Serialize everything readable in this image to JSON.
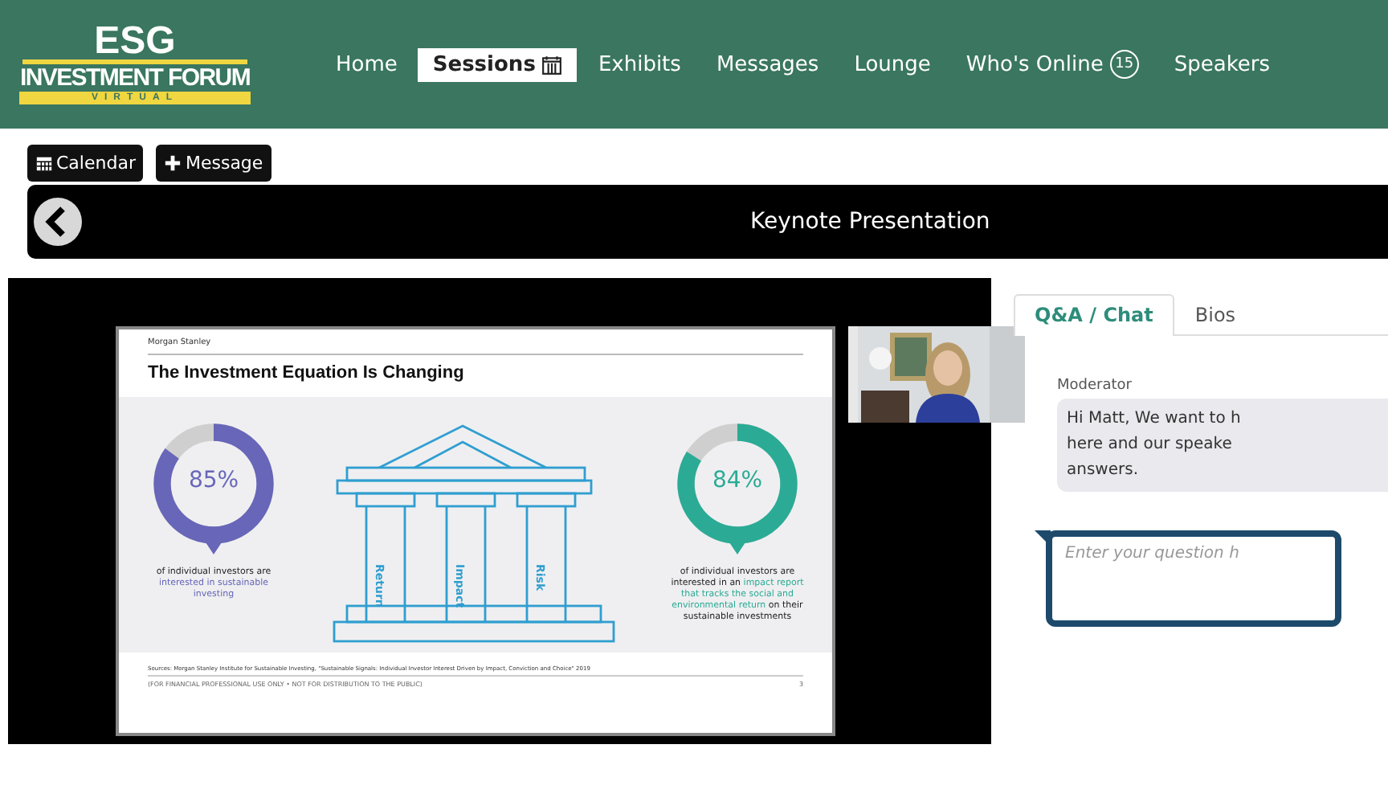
{
  "logo": {
    "top": "ESG",
    "middle": "INVESTMENT FORUM",
    "bottom": "VIRTUAL"
  },
  "nav": [
    {
      "label": "Home",
      "selected": false
    },
    {
      "label": "Sessions",
      "selected": true
    },
    {
      "label": "Exhibits",
      "selected": false
    },
    {
      "label": "Messages",
      "selected": false
    },
    {
      "label": "Lounge",
      "selected": false
    },
    {
      "label": "Who's Online",
      "selected": false,
      "badge": "15"
    },
    {
      "label": "Speakers",
      "selected": false
    }
  ],
  "actions": [
    {
      "label": "Calendar"
    },
    {
      "label": "Message"
    }
  ],
  "session_title": "Keynote Presentation",
  "slide": {
    "brand": "Morgan Stanley",
    "title": "The Investment Equation Is Changing",
    "stats": [
      {
        "value": "85%",
        "color": "#6766b8",
        "caption": [
          {
            "text": "of individual investors are ",
            "highlight": false
          },
          {
            "text": "interested in sustainable investing",
            "highlight": true
          }
        ]
      },
      {
        "value": "84%",
        "color": "#2bab95",
        "caption": [
          {
            "text": "of individual investors are interested in an ",
            "highlight": false
          },
          {
            "text": "impact report that tracks the social and environmental return",
            "highlight": true
          },
          {
            "text": " on their sustainable investments",
            "highlight": false
          }
        ]
      }
    ],
    "pillars": [
      "Return",
      "Impact",
      "Risk"
    ],
    "sources": "Sources: Morgan Stanley Institute for Sustainable Investing, \"Sustainable Signals: Individual Investor Interest Driven by Impact, Conviction and Choice\" 2019",
    "footer": "(FOR FINANCIAL PROFESSIONAL USE ONLY • NOT FOR DISTRIBUTION TO THE PUBLIC)",
    "page": "3"
  },
  "panel": {
    "tabs": [
      {
        "label": "Q&A / Chat",
        "selected": true
      },
      {
        "label": "Bios",
        "selected": false
      }
    ],
    "messages": [
      {
        "author": "Moderator",
        "text": "Hi Matt, We want to h\nhere and our speake\nanswers."
      }
    ],
    "question": {
      "placeholder": "Enter your question h"
    }
  }
}
